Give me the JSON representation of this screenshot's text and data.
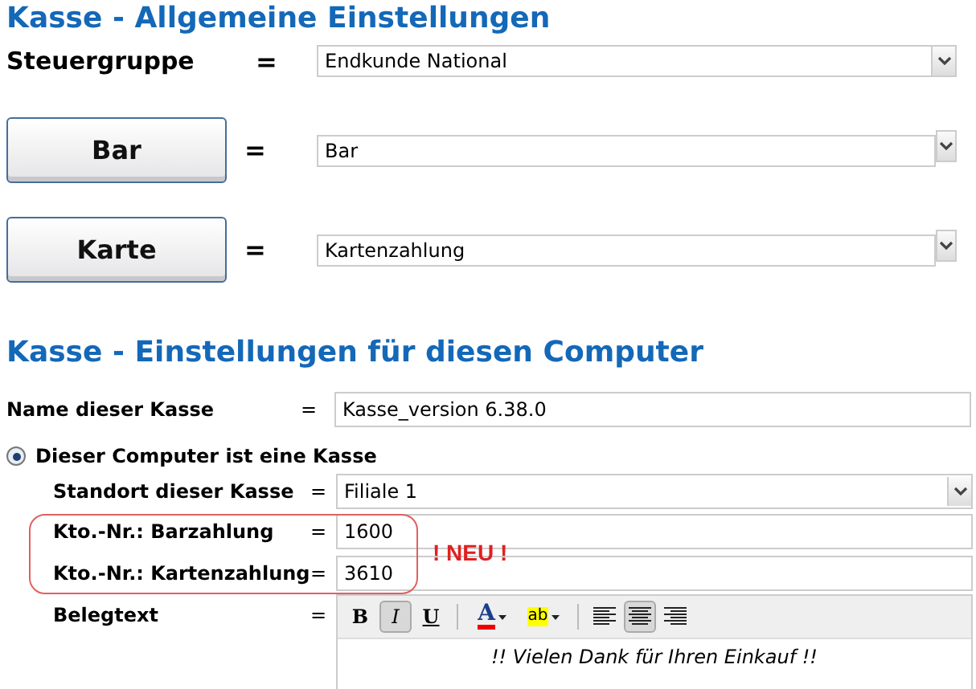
{
  "section_general": {
    "title": "Kasse - Allgemeine Einstellungen",
    "tax_group": {
      "label": "Steuergruppe",
      "equals": "=",
      "value": "Endkunde National"
    },
    "payment_rows": [
      {
        "button": "Bar",
        "equals": "=",
        "value": "Bar"
      },
      {
        "button": "Karte",
        "equals": "=",
        "value": "Kartenzahlung"
      }
    ]
  },
  "section_computer": {
    "title": "Kasse - Einstellungen für diesen Computer",
    "name_row": {
      "label": "Name dieser Kasse",
      "equals": "=",
      "value": "Kasse_version 6.38.0"
    },
    "radio": {
      "label": "Dieser Computer ist eine Kasse",
      "selected": true
    },
    "location": {
      "label": "Standort dieser Kasse",
      "equals": "=",
      "value": "Filiale 1"
    },
    "accounts": [
      {
        "label": "Kto.-Nr.: Barzahlung",
        "equals": "=",
        "value": "1600"
      },
      {
        "label": "Kto.-Nr.: Kartenzahlung",
        "equals": "=",
        "value": "3610"
      }
    ],
    "new_badge": "! NEU !",
    "receipt": {
      "label": "Belegtext",
      "equals": "=",
      "toolbar": [
        {
          "kind": "bold",
          "label": "B",
          "selected": false
        },
        {
          "kind": "italic",
          "label": "I",
          "selected": true
        },
        {
          "kind": "underline",
          "label": "U",
          "selected": false
        },
        {
          "kind": "separator"
        },
        {
          "kind": "fontcolor",
          "label": "A",
          "selected": false
        },
        {
          "kind": "highlight",
          "label": "ab",
          "selected": false
        },
        {
          "kind": "separator"
        },
        {
          "kind": "align-left",
          "selected": false
        },
        {
          "kind": "align-center",
          "selected": true
        },
        {
          "kind": "align-right",
          "selected": false
        }
      ],
      "text": "!! Vielen Dank für Ihren Einkauf !!"
    }
  }
}
